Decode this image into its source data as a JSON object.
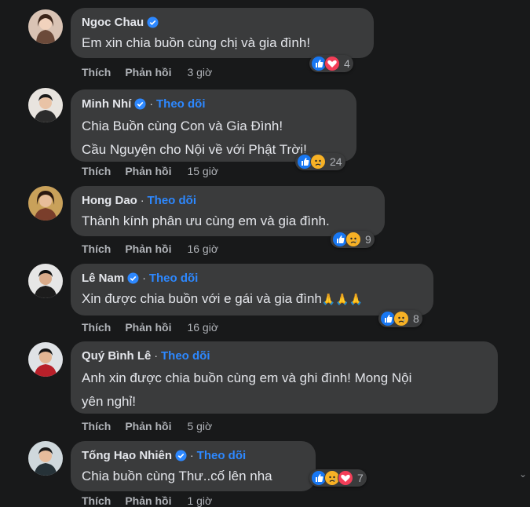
{
  "comments": [
    {
      "author": "Ngoc Chau",
      "follow": "",
      "lines": [
        "Em xin chia buồn cùng chị và gia đình!"
      ],
      "reaction_count": "4",
      "reactions": [
        "like-icon",
        "love-icon"
      ],
      "like": "Thích",
      "reply": "Phản hồi",
      "time": "3 giờ"
    },
    {
      "author": "Minh Nhí",
      "follow": "Theo dõi",
      "lines": [
        "Chia Buồn cùng Con và Gia Đình!",
        "Cầu Nguyện cho Nội về với Phật Trời!"
      ],
      "reaction_count": "24",
      "reactions": [
        "like-icon",
        "sad-icon"
      ],
      "like": "Thích",
      "reply": "Phản hồi",
      "time": "15 giờ"
    },
    {
      "author": "Hong Dao",
      "follow": "Theo dõi",
      "lines": [
        "Thành kính phân ưu cùng em và gia đình."
      ],
      "reaction_count": "9",
      "reactions": [
        "like-icon",
        "sad-icon"
      ],
      "like": "Thích",
      "reply": "Phản hồi",
      "time": "16 giờ"
    },
    {
      "author": "Lê Nam",
      "follow": "Theo dõi",
      "lines": [
        "Xin được chia buồn với e gái và gia đình"
      ],
      "emoji_suffix": "🙏🙏🙏",
      "reaction_count": "8",
      "reactions": [
        "like-icon",
        "sad-icon"
      ],
      "like": "Thích",
      "reply": "Phản hồi",
      "time": "16 giờ"
    },
    {
      "author": "Quý Bình Lê",
      "follow": "Theo dõi",
      "lines": [
        "Anh xin được chia buồn cùng em và ghi đình! Mong Nội",
        "yên nghỉ!"
      ],
      "reaction_count": "",
      "reactions": [],
      "like": "Thích",
      "reply": "Phản hồi",
      "time": "5 giờ"
    },
    {
      "author": "Tống Hạo Nhiên",
      "follow": "Theo dõi",
      "lines": [
        "Chia buồn cùng Thư..cố lên nha"
      ],
      "reaction_count": "7",
      "reactions": [
        "like-icon",
        "sad-icon",
        "love-icon"
      ],
      "like": "Thích",
      "reply": "Phản hồi",
      "time": "1 giờ"
    }
  ],
  "colors": {
    "background": "#18191a",
    "bubble": "#3a3b3c",
    "follow": "#2d88ff",
    "like": "#1877f2",
    "love": "#f33e58",
    "sad": "#f7b125"
  }
}
